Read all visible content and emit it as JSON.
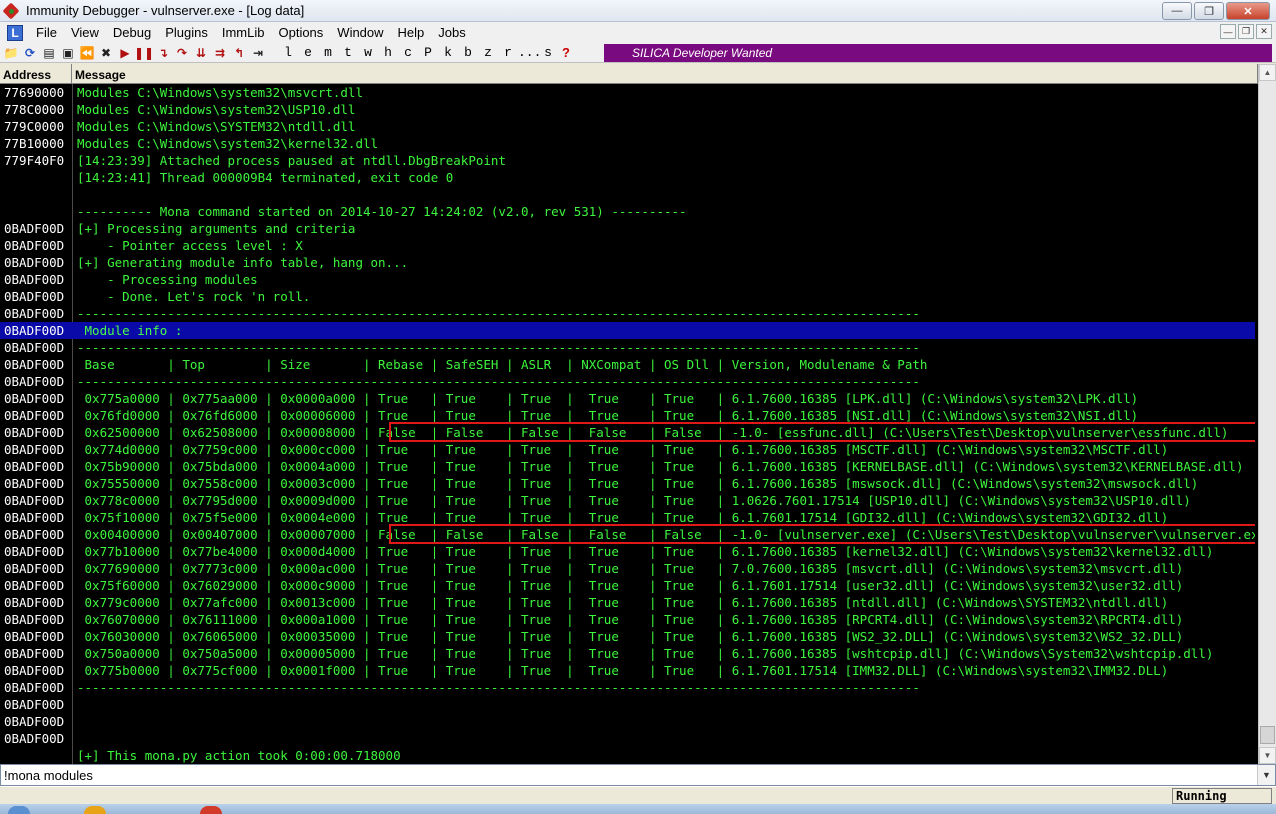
{
  "window": {
    "title": "Immunity Debugger - vulnserver.exe - [Log data]"
  },
  "menu": {
    "logo": "L",
    "items": [
      "File",
      "View",
      "Debug",
      "Plugins",
      "ImmLib",
      "Options",
      "Window",
      "Help",
      "Jobs"
    ]
  },
  "toolbar": {
    "letters": [
      "l",
      "e",
      "m",
      "t",
      "w",
      "h",
      "c",
      "P",
      "k",
      "b",
      "z",
      "r",
      "...",
      "s",
      "?"
    ],
    "banner": "SILICA Developer Wanted"
  },
  "log": {
    "headers": {
      "address": "Address",
      "message": "Message"
    },
    "rows": [
      {
        "addr": "77690000",
        "msg": "Modules C:\\Windows\\system32\\msvcrt.dll"
      },
      {
        "addr": "778C0000",
        "msg": "Modules C:\\Windows\\system32\\USP10.dll"
      },
      {
        "addr": "779C0000",
        "msg": "Modules C:\\Windows\\SYSTEM32\\ntdll.dll"
      },
      {
        "addr": "77B10000",
        "msg": "Modules C:\\Windows\\system32\\kernel32.dll"
      },
      {
        "addr": "779F40F0",
        "msg": "[14:23:39] Attached process paused at ntdll.DbgBreakPoint"
      },
      {
        "addr": "",
        "msg": "[14:23:41] Thread 000009B4 terminated, exit code 0"
      },
      {
        "addr": "",
        "msg": ""
      },
      {
        "addr": "",
        "msg": "---------- Mona command started on 2014-10-27 14:24:02 (v2.0, rev 531) ----------"
      },
      {
        "addr": "0BADF00D",
        "msg": "[+] Processing arguments and criteria"
      },
      {
        "addr": "0BADF00D",
        "msg": "    - Pointer access level : X"
      },
      {
        "addr": "0BADF00D",
        "msg": "[+] Generating module info table, hang on..."
      },
      {
        "addr": "0BADF00D",
        "msg": "    - Processing modules"
      },
      {
        "addr": "0BADF00D",
        "msg": "    - Done. Let's rock 'n roll."
      },
      {
        "addr": "0BADF00D",
        "msg": "----------------------------------------------------------------------------------------------------------------"
      },
      {
        "addr": "0BADF00D",
        "msg": " Module info :",
        "highlight": true
      },
      {
        "addr": "0BADF00D",
        "msg": "----------------------------------------------------------------------------------------------------------------"
      },
      {
        "addr": "0BADF00D",
        "msg": " Base       | Top        | Size       | Rebase | SafeSEH | ASLR  | NXCompat | OS Dll | Version, Modulename & Path"
      },
      {
        "addr": "0BADF00D",
        "msg": "----------------------------------------------------------------------------------------------------------------"
      },
      {
        "addr": "0BADF00D",
        "msg": " 0x775a0000 | 0x775aa000 | 0x0000a000 | True   | True    | True  |  True    | True   | 6.1.7600.16385 [LPK.dll] (C:\\Windows\\system32\\LPK.dll)"
      },
      {
        "addr": "0BADF00D",
        "msg": " 0x76fd0000 | 0x76fd6000 | 0x00006000 | True   | True    | True  |  True    | True   | 6.1.7600.16385 [NSI.dll] (C:\\Windows\\system32\\NSI.dll)"
      },
      {
        "addr": "0BADF00D",
        "msg": " 0x62500000 | 0x62508000 | 0x00008000 | False  | False   | False |  False   | False  | -1.0- [essfunc.dll] (C:\\Users\\Test\\Desktop\\vulnserver\\essfunc.dll)"
      },
      {
        "addr": "0BADF00D",
        "msg": " 0x774d0000 | 0x7759c000 | 0x000cc000 | True   | True    | True  |  True    | True   | 6.1.7600.16385 [MSCTF.dll] (C:\\Windows\\system32\\MSCTF.dll)"
      },
      {
        "addr": "0BADF00D",
        "msg": " 0x75b90000 | 0x75bda000 | 0x0004a000 | True   | True    | True  |  True    | True   | 6.1.7600.16385 [KERNELBASE.dll] (C:\\Windows\\system32\\KERNELBASE.dll)"
      },
      {
        "addr": "0BADF00D",
        "msg": " 0x75550000 | 0x7558c000 | 0x0003c000 | True   | True    | True  |  True    | True   | 6.1.7600.16385 [mswsock.dll] (C:\\Windows\\system32\\mswsock.dll)"
      },
      {
        "addr": "0BADF00D",
        "msg": " 0x778c0000 | 0x7795d000 | 0x0009d000 | True   | True    | True  |  True    | True   | 1.0626.7601.17514 [USP10.dll] (C:\\Windows\\system32\\USP10.dll)"
      },
      {
        "addr": "0BADF00D",
        "msg": " 0x75f10000 | 0x75f5e000 | 0x0004e000 | True   | True    | True  |  True    | True   | 6.1.7601.17514 [GDI32.dll] (C:\\Windows\\system32\\GDI32.dll)"
      },
      {
        "addr": "0BADF00D",
        "msg": " 0x00400000 | 0x00407000 | 0x00007000 | False  | False   | False |  False   | False  | -1.0- [vulnserver.exe] (C:\\Users\\Test\\Desktop\\vulnserver\\vulnserver.exe)"
      },
      {
        "addr": "0BADF00D",
        "msg": " 0x77b10000 | 0x77be4000 | 0x000d4000 | True   | True    | True  |  True    | True   | 6.1.7600.16385 [kernel32.dll] (C:\\Windows\\system32\\kernel32.dll)"
      },
      {
        "addr": "0BADF00D",
        "msg": " 0x77690000 | 0x7773c000 | 0x000ac000 | True   | True    | True  |  True    | True   | 7.0.7600.16385 [msvcrt.dll] (C:\\Windows\\system32\\msvcrt.dll)"
      },
      {
        "addr": "0BADF00D",
        "msg": " 0x75f60000 | 0x76029000 | 0x000c9000 | True   | True    | True  |  True    | True   | 6.1.7601.17514 [user32.dll] (C:\\Windows\\system32\\user32.dll)"
      },
      {
        "addr": "0BADF00D",
        "msg": " 0x779c0000 | 0x77afc000 | 0x0013c000 | True   | True    | True  |  True    | True   | 6.1.7600.16385 [ntdll.dll] (C:\\Windows\\SYSTEM32\\ntdll.dll)"
      },
      {
        "addr": "0BADF00D",
        "msg": " 0x76070000 | 0x76111000 | 0x000a1000 | True   | True    | True  |  True    | True   | 6.1.7600.16385 [RPCRT4.dll] (C:\\Windows\\system32\\RPCRT4.dll)"
      },
      {
        "addr": "0BADF00D",
        "msg": " 0x76030000 | 0x76065000 | 0x00035000 | True   | True    | True  |  True    | True   | 6.1.7600.16385 [WS2_32.DLL] (C:\\Windows\\system32\\WS2_32.DLL)"
      },
      {
        "addr": "0BADF00D",
        "msg": " 0x750a0000 | 0x750a5000 | 0x00005000 | True   | True    | True  |  True    | True   | 6.1.7600.16385 [wshtcpip.dll] (C:\\Windows\\System32\\wshtcpip.dll)"
      },
      {
        "addr": "0BADF00D",
        "msg": " 0x775b0000 | 0x775cf000 | 0x0001f000 | True   | True    | True  |  True    | True   | 6.1.7601.17514 [IMM32.DLL] (C:\\Windows\\system32\\IMM32.DLL)"
      },
      {
        "addr": "0BADF00D",
        "msg": "----------------------------------------------------------------------------------------------------------------"
      },
      {
        "addr": "0BADF00D",
        "msg": ""
      },
      {
        "addr": "0BADF00D",
        "msg": ""
      },
      {
        "addr": "0BADF00D",
        "msg": ""
      },
      {
        "addr": "",
        "msg": "[+] This mona.py action took 0:00:00.718000"
      }
    ]
  },
  "command": {
    "value": "!mona modules"
  },
  "status": {
    "text": "Running"
  },
  "colors": {
    "log_text": "#3df53d",
    "log_background": "#000000",
    "highlight_row": "#0a0aa8",
    "annotation_box": "#e01818",
    "banner_background": "#7a0a7f"
  }
}
